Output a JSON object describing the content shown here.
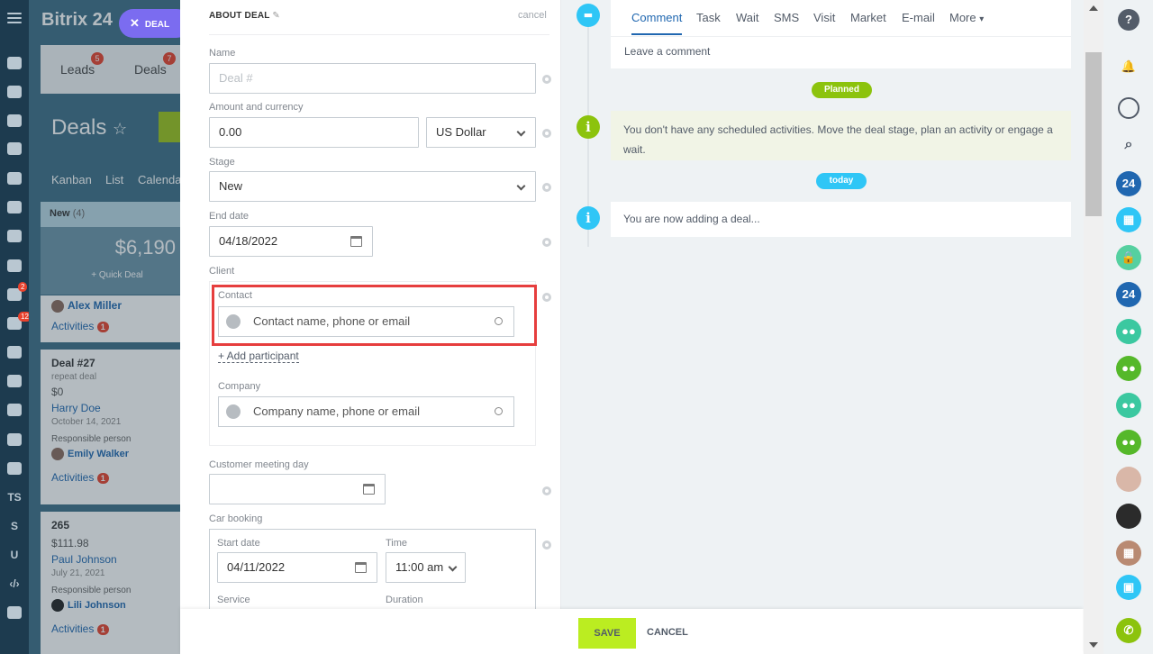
{
  "app": {
    "logo": "Bitrix 24",
    "deal_pill": "DEAL"
  },
  "left_nav": {
    "badges": [
      "2",
      "12"
    ],
    "texts": [
      "TS",
      "S",
      "U",
      "‹/›"
    ]
  },
  "crm_bg": {
    "tabs": [
      {
        "label": "Leads",
        "badge": "5"
      },
      {
        "label": "Deals",
        "badge": "7"
      }
    ],
    "title": "Deals",
    "views": [
      "Kanban",
      "List",
      "Calenda"
    ],
    "column": {
      "name": "New",
      "count": "(4)",
      "sum": "$6,190",
      "quick": "+ Quick Deal"
    },
    "cards": [
      {
        "contact": "Alex Miller",
        "activities": "Activities",
        "act_count": "1"
      },
      {
        "title": "Deal #27",
        "sub": "repeat deal",
        "amount": "$0",
        "contact": "Harry Doe",
        "date": "October 14, 2021",
        "resp_label": "Responsible person",
        "resp": "Emily Walker",
        "activities": "Activities",
        "act_count": "1"
      },
      {
        "title": "265",
        "amount": "$111.98",
        "contact": "Paul Johnson",
        "date": "July 21, 2021",
        "resp_label": "Responsible person",
        "resp": "Lili Johnson",
        "activities": "Activities",
        "act_count": "1"
      }
    ]
  },
  "form": {
    "section_title": "ABOUT DEAL",
    "section_cancel": "cancel",
    "name": {
      "label": "Name",
      "placeholder": "Deal #"
    },
    "amount": {
      "label": "Amount and currency",
      "value": "0.00",
      "currency": "US Dollar"
    },
    "stage": {
      "label": "Stage",
      "value": "New"
    },
    "end_date": {
      "label": "End date",
      "value": "04/18/2022"
    },
    "client": {
      "label": "Client",
      "contact_label": "Contact",
      "contact_placeholder": "Contact name, phone or email",
      "add_participant": "+ Add participant",
      "company_label": "Company",
      "company_placeholder": "Company name, phone or email"
    },
    "meeting": {
      "label": "Customer meeting day"
    },
    "car": {
      "label": "Car booking",
      "start_label": "Start date",
      "start_value": "04/11/2022",
      "time_label": "Time",
      "time_value": "11:00 am",
      "service_label": "Service",
      "duration_label": "Duration"
    }
  },
  "footer": {
    "save": "SAVE",
    "cancel": "CANCEL"
  },
  "timeline": {
    "tabs": [
      "Comment",
      "Task",
      "Wait",
      "SMS",
      "Visit",
      "Market",
      "E-mail",
      "More"
    ],
    "comment_placeholder": "Leave a comment",
    "planned": "Planned",
    "planned_text": "You don't have any scheduled activities. Move the deal stage, plan an activity or engage a wait.",
    "today": "today",
    "adding_text": "You are now adding a deal..."
  },
  "right_bar": {
    "items": [
      "?",
      "24",
      "24"
    ]
  },
  "colors": {
    "save_green": "#bbed21",
    "highlight_red": "#e63e3e",
    "planned_green": "#8cc30d",
    "today_blue": "#2fc6f6",
    "link_blue": "#2067b0"
  }
}
